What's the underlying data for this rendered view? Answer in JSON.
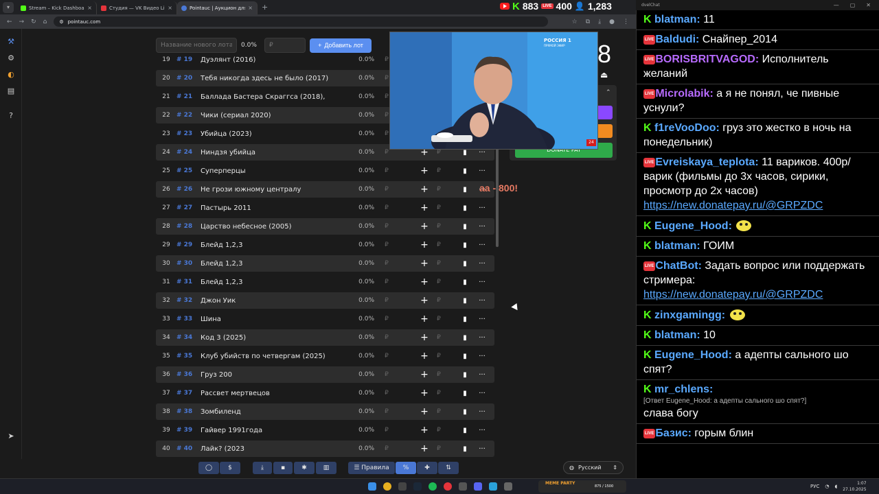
{
  "browser": {
    "tabs": [
      {
        "title": "Stream – Kick Dashboard",
        "color": "#53fc18",
        "active": false
      },
      {
        "title": "Студия — VK Видео Live",
        "color": "#e5343b",
        "active": false
      },
      {
        "title": "Pointauc | Аукцион для стрим",
        "color": "#4a78d6",
        "active": true
      }
    ],
    "url": "pointauc.com",
    "counters": {
      "kick": "883",
      "vk": "400",
      "viewers": "1,283",
      "live": "LIVE"
    }
  },
  "lot_input": {
    "placeholder": "Название нового лота",
    "percent": "0.0%",
    "currency": "₽",
    "add_label": "Добавить лот"
  },
  "lots": [
    {
      "n": "19",
      "id": "# 19",
      "name": "Дуэлянт (2016)"
    },
    {
      "n": "20",
      "id": "# 20",
      "name": "Тебя никогда здесь не было (2017)"
    },
    {
      "n": "21",
      "id": "# 21",
      "name": "Баллада Бастера Скраггса (2018),"
    },
    {
      "n": "22",
      "id": "# 22",
      "name": "Чики (сериал 2020)"
    },
    {
      "n": "23",
      "id": "# 23",
      "name": "Убийца (2023)"
    },
    {
      "n": "24",
      "id": "# 24",
      "name": "Ниндзя убийца"
    },
    {
      "n": "25",
      "id": "# 25",
      "name": "Суперперцы"
    },
    {
      "n": "26",
      "id": "# 26",
      "name": "Не грози южному централу"
    },
    {
      "n": "27",
      "id": "# 27",
      "name": "Пастырь 2011"
    },
    {
      "n": "28",
      "id": "# 28",
      "name": "Царство небесное (2005)"
    },
    {
      "n": "29",
      "id": "# 29",
      "name": "Блейд 1,2,3"
    },
    {
      "n": "30",
      "id": "# 30",
      "name": "Блейд 1,2,3"
    },
    {
      "n": "31",
      "id": "# 31",
      "name": "Блейд 1,2,3"
    },
    {
      "n": "32",
      "id": "# 32",
      "name": "Джон Уик"
    },
    {
      "n": "33",
      "id": "# 33",
      "name": "Шина"
    },
    {
      "n": "34",
      "id": "# 34",
      "name": "Код 3 (2025)"
    },
    {
      "n": "35",
      "id": "# 35",
      "name": "Клуб убийств по четвергам (2025)"
    },
    {
      "n": "36",
      "id": "# 36",
      "name": "Груз 200"
    },
    {
      "n": "37",
      "id": "# 37",
      "name": "Рассвет мертвецов"
    },
    {
      "n": "38",
      "id": "# 38",
      "name": "Зомбиленд"
    },
    {
      "n": "39",
      "id": "# 39",
      "name": "Гайвер 1991года"
    },
    {
      "n": "40",
      "id": "# 40",
      "name": "Лайк? (2023"
    }
  ],
  "lot_percent": "0.0%",
  "lot_currency": "₽",
  "timer_digit": "8",
  "donate_label": "DONATE PAY",
  "overlay_text": "аа - 800!",
  "video": {
    "channel": "РОССИЯ 1",
    "sub": "ПРЯМОЙ ЭФИР",
    "badge": "24"
  },
  "toolbar": {
    "rules": "Правила",
    "percent_btn": "%"
  },
  "language": "Русский",
  "chat_title": "dvelChat",
  "chat": [
    {
      "p": "kick",
      "nick": "blatman",
      "color": "#5aa9ff",
      "text": "11"
    },
    {
      "p": "vk",
      "nick": "Baldudi",
      "color": "#5aa9ff",
      "text": "Снайпер_2014"
    },
    {
      "p": "vk",
      "nick": "BORISBRITVAGOD",
      "color": "#b86bff",
      "text": "Исполнитель желаний"
    },
    {
      "p": "vk",
      "nick": "Microlabik",
      "color": "#b86bff",
      "text": "а я не понял, че пивные уснули?"
    },
    {
      "p": "kick",
      "nick": "f1reVooDoo",
      "color": "#5aa9ff",
      "text": "груз это жестко в ночь на понедельник)"
    },
    {
      "p": "vk",
      "nick": "Evreiskaya_teplota",
      "color": "#5aa9ff",
      "text": "11 вариков. 400р/варик (фильмы до 3х часов, сирики, просмотр до 2х часов)",
      "link": "https://new.donatepay.ru/@GRPZDC"
    },
    {
      "p": "kick",
      "nick": "Eugene_Hood",
      "color": "#5aa9ff",
      "text": ""
    },
    {
      "p": "kick",
      "nick": "blatman",
      "color": "#5aa9ff",
      "text": "ГОИМ"
    },
    {
      "p": "vk",
      "nick": "ChatBot",
      "color": "#5aa9ff",
      "text": "Задать вопрос или поддержать стримера:",
      "link": "https://new.donatepay.ru/@GRPZDC"
    },
    {
      "p": "kick",
      "nick": "zinxgamingg",
      "color": "#5aa9ff",
      "text": ""
    },
    {
      "p": "kick",
      "nick": "blatman",
      "color": "#5aa9ff",
      "text": "10"
    },
    {
      "p": "kick",
      "nick": "Eugene_Hood",
      "color": "#5aa9ff",
      "text": "а адепты сального шо спят?"
    },
    {
      "p": "kick",
      "nick": "mr_chlens",
      "color": "#5aa9ff",
      "reply": "[Ответ Eugene_Hood: а адепты сального шо спят?]",
      "text": "слава богу"
    },
    {
      "p": "vk",
      "nick": "Базис",
      "color": "#5aa9ff",
      "text": "горым блин"
    }
  ],
  "taskbar": {
    "lang": "РУС",
    "time": "1:07",
    "date": "27.10.2025",
    "meme_label": "MEME PARTY",
    "meme_count": "875 / 1500"
  }
}
